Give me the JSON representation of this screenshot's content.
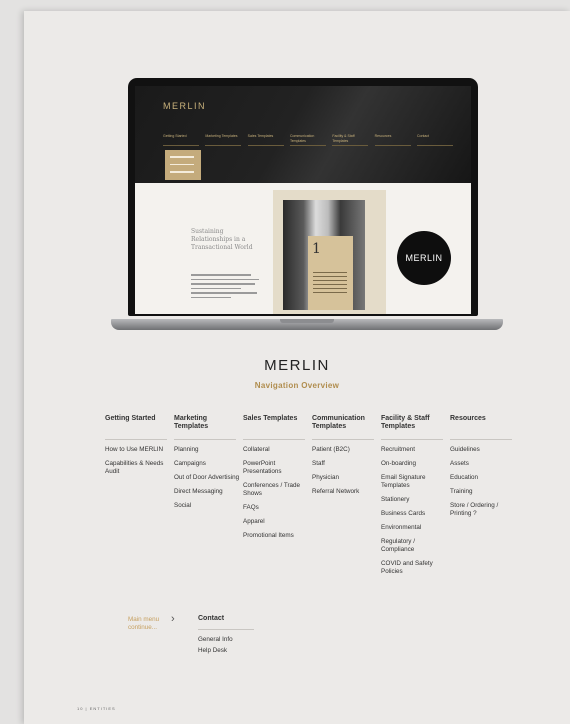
{
  "laptop_screen": {
    "logo": "MERLIN",
    "nav": [
      "Getting Started",
      "Marketing Templates",
      "Sales Templates",
      "Communication Templates",
      "Facility & Staff Templates",
      "Resources",
      "Contact"
    ],
    "headline": "Sustaining Relationships in a Transactional World",
    "booklet_numeral": "1",
    "circle_logo": "MERLIN"
  },
  "title": "MERLIN",
  "subtitle": "Navigation Overview",
  "columns": [
    {
      "heading": "Getting Started",
      "items": [
        "How to Use MERLIN",
        "Capabilities & Needs Audit"
      ]
    },
    {
      "heading": "Marketing Templates",
      "items": [
        "Planning",
        "Campaigns",
        "Out of Door Advertising",
        "Direct Messaging",
        "Social"
      ]
    },
    {
      "heading": "Sales Templates",
      "items": [
        "Collateral",
        "PowerPoint Presentations",
        "Conferences / Trade Shows",
        "FAQs",
        "Apparel",
        "Promotional Items"
      ]
    },
    {
      "heading": "Communication Templates",
      "items": [
        "Patient (B2C)",
        "Staff",
        "Physician",
        "Referral Network"
      ]
    },
    {
      "heading": "Facility & Staff Templates",
      "items": [
        "Recruitment",
        "On-boarding",
        "Email Signature Templates",
        "Stationery",
        "Business Cards",
        "Environmental",
        "Regulatory / Compliance",
        "COVID and Safety Policies"
      ]
    },
    {
      "heading": "Resources",
      "items": [
        "Guidelines",
        "Assets",
        "Education",
        "Training",
        "Store / Ordering / Printing ?"
      ]
    }
  ],
  "main_menu_more": "Main menu continue...",
  "contact": {
    "heading": "Contact",
    "items": [
      "General Info",
      "Help Desk"
    ]
  },
  "footer": "10  |  ENTITIES"
}
